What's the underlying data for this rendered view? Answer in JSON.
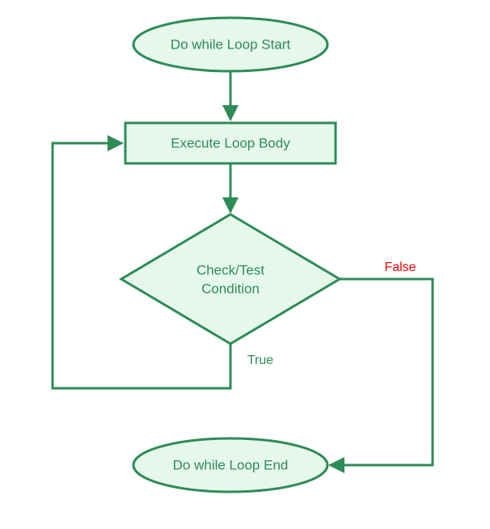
{
  "nodes": {
    "start": "Do while Loop Start",
    "body": "Execute Loop Body",
    "cond_line1": "Check/Test",
    "cond_line2": "Condition",
    "end": "Do while Loop End"
  },
  "edges": {
    "true_label": "True",
    "false_label": "False"
  },
  "colors": {
    "stroke": "#2e8b57",
    "fill": "#e6f7ec",
    "true": "#2e8b57",
    "false": "#ff0000"
  }
}
